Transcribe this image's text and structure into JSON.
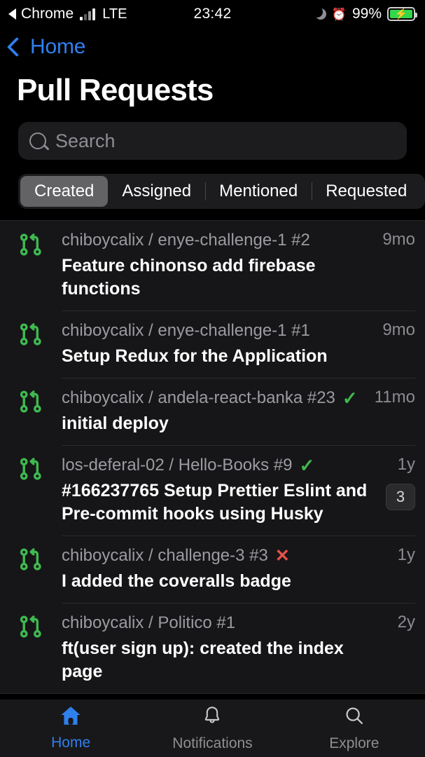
{
  "status_bar": {
    "back_app_label": "Chrome",
    "network": "LTE",
    "time": "23:42",
    "battery_percent": "99%",
    "moon_icon": "moon-icon",
    "alarm_icon": "alarm-clock-icon",
    "battery_icon": "battery-charging-icon",
    "signal_icon": "signal-bars-icon"
  },
  "nav": {
    "back_label": "Home",
    "back_icon": "chevron-left-icon"
  },
  "header": {
    "title": "Pull Requests"
  },
  "search": {
    "placeholder": "Search",
    "value": "",
    "icon": "search-icon"
  },
  "segmented": {
    "selected": "Created",
    "options": [
      "Created",
      "Assigned",
      "Mentioned",
      "Requested"
    ]
  },
  "colors": {
    "accent_blue": "#2f80ed",
    "pr_green": "#3fb950",
    "fail_red": "#e5534b",
    "background": "#000000",
    "list_background": "#161618"
  },
  "pull_requests": [
    {
      "icon": "git-pull-request-icon",
      "repo": "chiboycalix / enye-challenge-1 #2",
      "title": "Feature chinonso add firebase functions",
      "age": "9mo",
      "status": "",
      "comments": ""
    },
    {
      "icon": "git-pull-request-icon",
      "repo": "chiboycalix / enye-challenge-1 #1",
      "title": "Setup Redux for the Application",
      "age": "9mo",
      "status": "",
      "comments": ""
    },
    {
      "icon": "git-pull-request-icon",
      "repo": "chiboycalix / andela-react-banka #23",
      "title": "initial deploy",
      "age": "11mo",
      "status": "success",
      "comments": ""
    },
    {
      "icon": "git-pull-request-icon",
      "repo": "los-deferal-02 / Hello-Books #9",
      "title": "#166237765 Setup Prettier Eslint and Pre-commit hooks using Husky",
      "age": "1y",
      "status": "success",
      "comments": "3"
    },
    {
      "icon": "git-pull-request-icon",
      "repo": "chiboycalix / challenge-3 #3",
      "title": "I added the coveralls badge",
      "age": "1y",
      "status": "failure",
      "comments": ""
    },
    {
      "icon": "git-pull-request-icon",
      "repo": "chiboycalix / Politico #1",
      "title": "ft(user sign up): created the index page",
      "age": "2y",
      "status": "",
      "comments": ""
    }
  ],
  "tabbar": {
    "active": "Home",
    "items": [
      {
        "label": "Home",
        "icon": "home-icon"
      },
      {
        "label": "Notifications",
        "icon": "bell-icon"
      },
      {
        "label": "Explore",
        "icon": "search-icon"
      }
    ]
  },
  "status_glyphs": {
    "success": "✓",
    "failure": "✕"
  }
}
